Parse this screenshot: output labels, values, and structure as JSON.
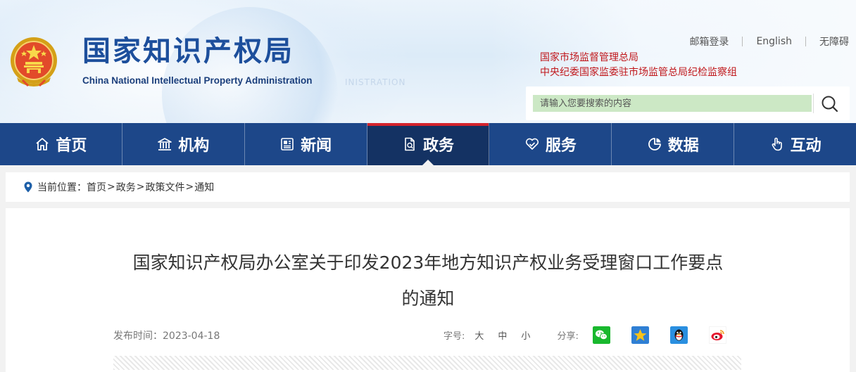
{
  "header": {
    "title": "国家知识产权局",
    "subtitle": "China National Intellectual Property Administration",
    "emblem_icon": "national-emblem-icon",
    "colors": {
      "title": "#1d4f9c",
      "related_links": "#c0171b"
    }
  },
  "top_links": {
    "login": "邮箱登录",
    "english": "English",
    "accessibility": "无障碍"
  },
  "related_links": [
    "国家市场监督管理总局",
    "中央纪委国家监委驻市场监管总局纪检监察组"
  ],
  "search": {
    "placeholder": "请输入您要搜索的内容",
    "icon": "search-icon"
  },
  "nav": {
    "colors": {
      "bar": "#1d4789",
      "active": "#143263",
      "active_marker": "#d4232c"
    },
    "items": [
      {
        "label": "首页",
        "icon": "home-icon",
        "active": false
      },
      {
        "label": "机构",
        "icon": "building-icon",
        "active": false
      },
      {
        "label": "新闻",
        "icon": "newspaper-icon",
        "active": false
      },
      {
        "label": "政务",
        "icon": "document-icon",
        "active": true
      },
      {
        "label": "服务",
        "icon": "heart-hand-icon",
        "active": false
      },
      {
        "label": "数据",
        "icon": "pie-chart-icon",
        "active": false
      },
      {
        "label": "互动",
        "icon": "hand-pointer-icon",
        "active": false
      }
    ]
  },
  "breadcrumb": {
    "prefix": "当前位置：",
    "separator": ">",
    "items": [
      "首页",
      "政务",
      "政策文件",
      "通知"
    ],
    "icon": "location-pin-icon"
  },
  "article": {
    "title_line1": "国家知识产权局办公室关于印发2023年地方知识产权业务受理窗口工作要点",
    "title_line2": "的通知",
    "publish_label": "发布时间：",
    "publish_date": "2023-04-18",
    "font_size_label": "字号:",
    "font_sizes": [
      "大",
      "中",
      "小"
    ],
    "share_label": "分享:",
    "share_icons": [
      "wechat-icon",
      "qzone-star-icon",
      "qq-penguin-icon",
      "weibo-icon"
    ]
  }
}
